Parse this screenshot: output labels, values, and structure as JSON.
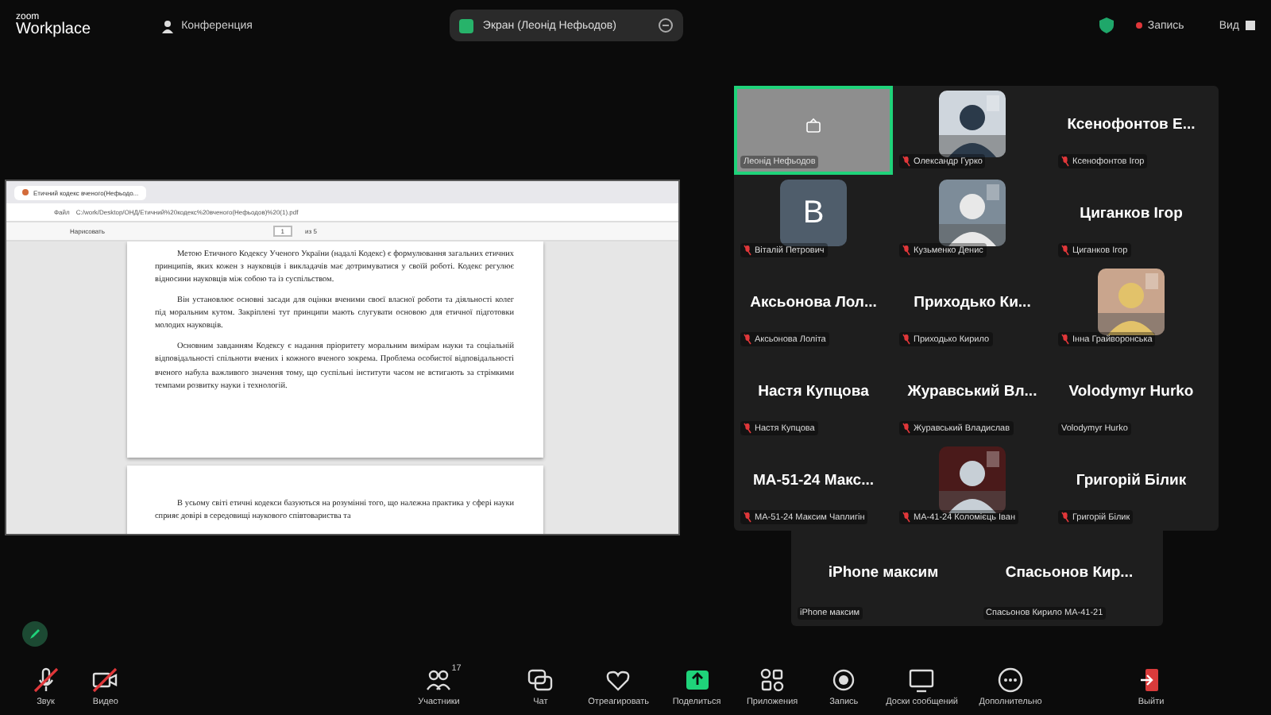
{
  "top_bar": {
    "logo_small": "zoom",
    "logo": "Workplace",
    "meeting": "Конференция",
    "share_pill": "Экран (Леонід Нефьодов)",
    "recording": "Запись",
    "view": "Вид"
  },
  "shared_window": {
    "tab_title": "Етичний кодекс вченого(Нефьодо...",
    "url_label": "Файл",
    "url": "C:/work/Desktop/ОНД/Етичний%20кодекс%20вченого(Нефьодов)%20(1).pdf",
    "draw_tool": "Нарисовать",
    "page": "1",
    "page_total": "из 5",
    "paragraphs": [
      "Метою Етичного Кодексу Ученого України (надалі Кодекс) є формулювання загальних етичних принципів, яких кожен з науковців і викладачів має дотримуватися у своїй роботі. Кодекс регулює відносини науковців між собою та із суспільством.",
      "Він установлює основні засади для оцінки вченими своєї власної роботи та діяльності колег під моральним кутом. Закріплені тут принципи мають слугувати основою для етичної підготовки молодих науковців.",
      "Основним завданням Кодексу є надання пріоритету моральним вимірам науки та соціальній відповідальності спільноти вчених і кожного вченого зокрема. Проблема особистої відповідальності вченого набула важливого значення тому, що суспільні інститути часом не встигають за стрімкими темпами розвитку науки і технологій."
    ],
    "next_page_text": "В усьому світі етичні кодекси базуються на розумінні того, що належна практика у сфері науки сприяє довірі в середовищі наукового співтовариства та"
  },
  "participants": [
    {
      "kind": "screen",
      "label": "Леонід Нефьодов",
      "muted": false,
      "active": true
    },
    {
      "kind": "picture",
      "label": "Олександр Гурко",
      "muted": true,
      "active": false
    },
    {
      "kind": "name",
      "display": "Ксенофонтов Е...",
      "label": "Ксенофонтов Ігор",
      "muted": true,
      "active": false
    },
    {
      "kind": "avatar",
      "letter": "В",
      "label": "Віталій Петрович",
      "muted": true,
      "active": false
    },
    {
      "kind": "picture",
      "label": "Кузьменко Денис",
      "muted": true,
      "active": false
    },
    {
      "kind": "name",
      "display": "Циганков Ігор",
      "label": "Циганков Ігор",
      "muted": true,
      "active": false
    },
    {
      "kind": "name",
      "display": "Аксьонова Лол...",
      "label": "Аксьонова Лоліта",
      "muted": true,
      "active": false
    },
    {
      "kind": "name",
      "display": "Приходько Ки...",
      "label": "Приходько Кирило",
      "muted": true,
      "active": false
    },
    {
      "kind": "picture",
      "label": "Інна Грайворонська",
      "muted": true,
      "active": false
    },
    {
      "kind": "name",
      "display": "Настя Купцова",
      "label": "Настя Купцова",
      "muted": true,
      "active": false
    },
    {
      "kind": "name",
      "display": "Журавський Вл...",
      "label": "Журавський Владислав",
      "muted": true,
      "active": false
    },
    {
      "kind": "name",
      "display": "Volodymyr Hurko",
      "label": "Volodymyr Hurko",
      "muted": false,
      "active": false
    },
    {
      "kind": "name",
      "display": "МА-51-24 Макс...",
      "label": "МА-51-24 Максим Чаплигін",
      "muted": true,
      "active": false
    },
    {
      "kind": "picture",
      "label": "МА-41-24 Коломієць Іван",
      "muted": true,
      "active": false
    },
    {
      "kind": "name",
      "display": "Григорій Білик",
      "label": "Григорій Білик",
      "muted": true,
      "active": false
    }
  ],
  "extra_participants": [
    {
      "kind": "name",
      "display": "iPhone максим",
      "label": "iPhone максим",
      "muted": false,
      "active": false
    },
    {
      "kind": "name",
      "display": "Спасьонов Кир...",
      "label": "Спасьонов Кирило МА-41-21",
      "muted": false,
      "active": false
    }
  ],
  "toolbar": [
    {
      "label": "Звук",
      "off": true
    },
    {
      "label": "Видео",
      "off": true
    },
    {
      "label": "Участники",
      "count": "17",
      "off": false
    },
    {
      "label": "Чат",
      "off": false
    },
    {
      "label": "Отреагировать",
      "off": false
    },
    {
      "label": "Поделиться",
      "off": false
    },
    {
      "label": "Приложения",
      "off": false
    },
    {
      "label": "Запись",
      "off": false
    },
    {
      "label": "Доски сообщений",
      "off": false
    },
    {
      "label": "Дополнительно",
      "off": false
    },
    {
      "label": "Выйти",
      "off": false
    }
  ]
}
